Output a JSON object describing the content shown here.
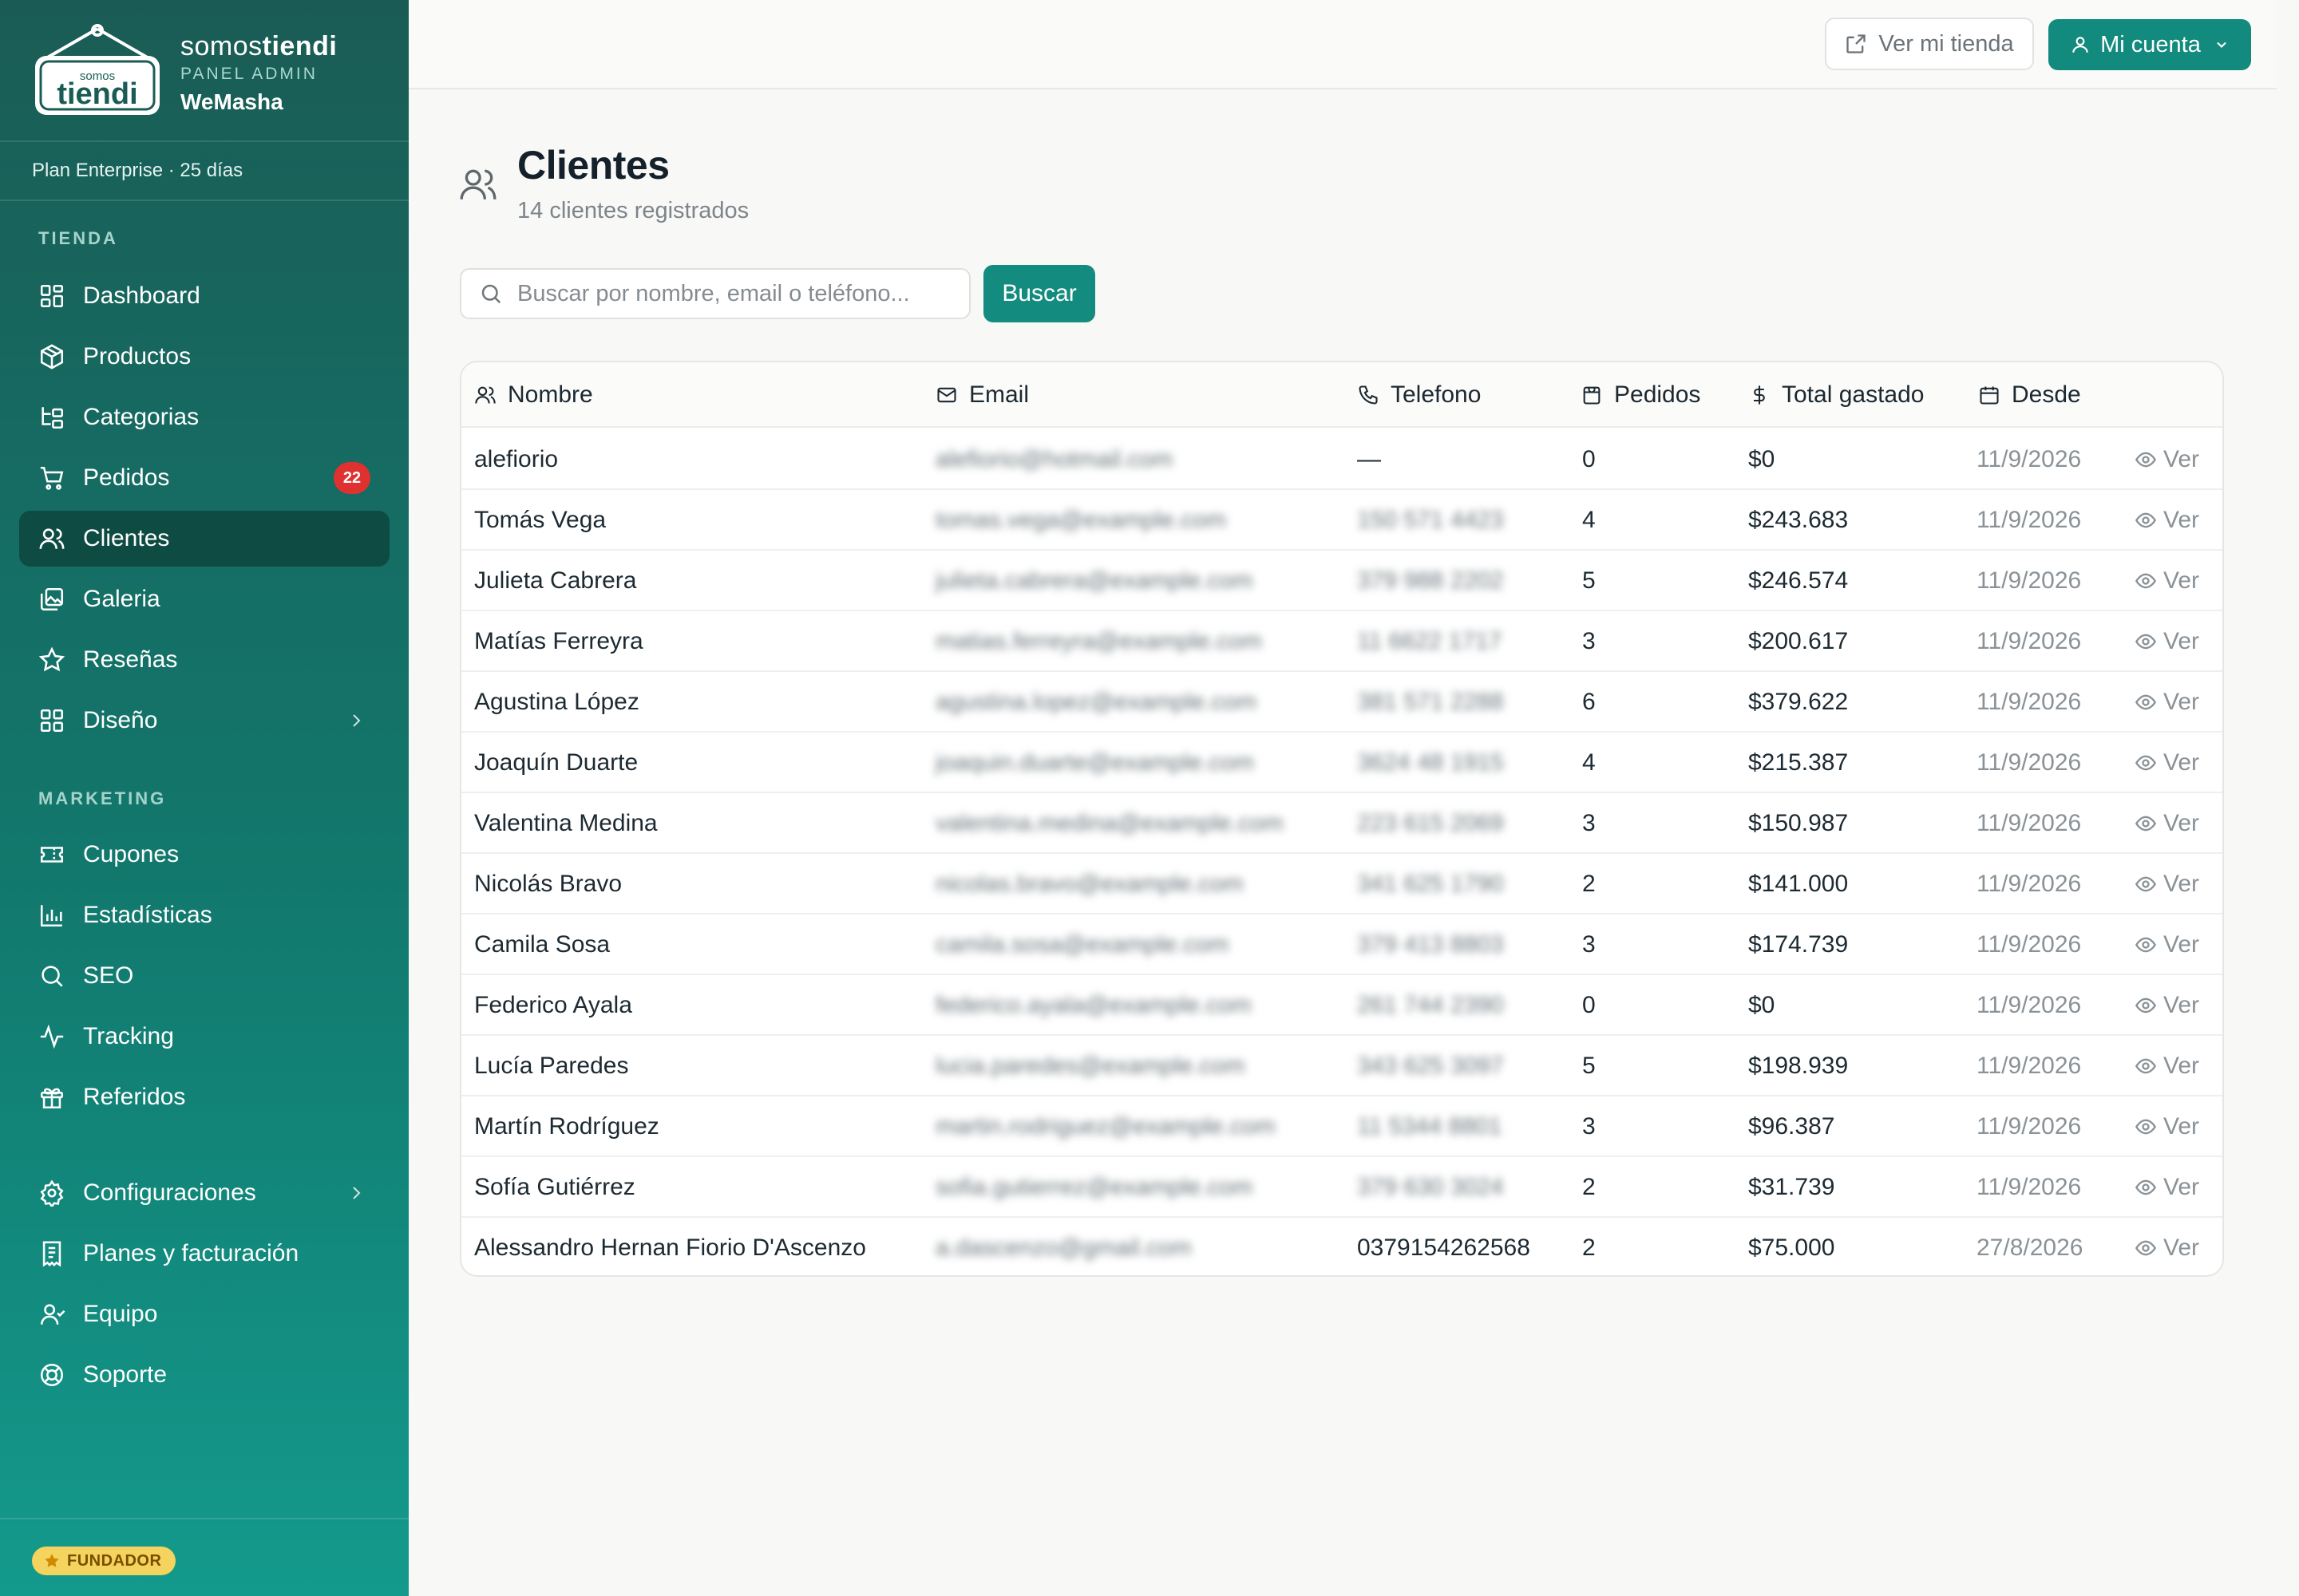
{
  "brand": {
    "logo_small": "somos",
    "logo_big": "tiendi",
    "name_light": "somos",
    "name_bold": "tiendi",
    "subtitle": "PANEL ADMIN",
    "store": "WeMasha"
  },
  "plan": "Plan Enterprise · 25 días",
  "sidebar": {
    "section_tienda": "TIENDA",
    "section_marketing": "MARKETING",
    "items": [
      {
        "label": "Dashboard",
        "icon": "grid-icon"
      },
      {
        "label": "Productos",
        "icon": "box-icon"
      },
      {
        "label": "Categorias",
        "icon": "tree-icon"
      },
      {
        "label": "Pedidos",
        "icon": "cart-icon",
        "badge": "22"
      },
      {
        "label": "Clientes",
        "icon": "users-icon",
        "active": true
      },
      {
        "label": "Galeria",
        "icon": "images-icon"
      },
      {
        "label": "Reseñas",
        "icon": "star-icon"
      },
      {
        "label": "Diseño",
        "icon": "layout-icon"
      },
      {
        "label": "Cupones",
        "icon": "ticket-icon"
      },
      {
        "label": "Estadísticas",
        "icon": "bar-chart-icon"
      },
      {
        "label": "SEO",
        "icon": "search-icon"
      },
      {
        "label": "Tracking",
        "icon": "activity-icon"
      },
      {
        "label": "Referidos",
        "icon": "gift-icon"
      },
      {
        "label": "Configuraciones",
        "icon": "gear-icon"
      },
      {
        "label": "Planes y facturación",
        "icon": "receipt-icon"
      },
      {
        "label": "Equipo",
        "icon": "team-icon"
      },
      {
        "label": "Soporte",
        "icon": "lifebuoy-icon"
      }
    ],
    "founder_badge": "FUNDADOR"
  },
  "topbar": {
    "view_store": "Ver mi tienda",
    "account": "Mi cuenta"
  },
  "page": {
    "title": "Clientes",
    "subtitle": "14 clientes registrados"
  },
  "search": {
    "placeholder": "Buscar por nombre, email o teléfono...",
    "button": "Buscar"
  },
  "table": {
    "headers": {
      "name": "Nombre",
      "email": "Email",
      "phone": "Telefono",
      "orders": "Pedidos",
      "total": "Total gastado",
      "since": "Desde"
    },
    "action_label": "Ver",
    "rows": [
      {
        "name": "alefiorio",
        "email": "alefiorio@hotmail.com",
        "phone": "—",
        "orders": "0",
        "total": "$0",
        "since": "11/9/2026"
      },
      {
        "name": "Tomás Vega",
        "email": "tomas.vega@example.com",
        "phone": "150 571 4423",
        "orders": "4",
        "total": "$243.683",
        "since": "11/9/2026"
      },
      {
        "name": "Julieta Cabrera",
        "email": "julieta.cabrera@example.com",
        "phone": "379 988 2202",
        "orders": "5",
        "total": "$246.574",
        "since": "11/9/2026"
      },
      {
        "name": "Matías Ferreyra",
        "email": "matias.ferreyra@example.com",
        "phone": "11 6622 1717",
        "orders": "3",
        "total": "$200.617",
        "since": "11/9/2026"
      },
      {
        "name": "Agustina López",
        "email": "agustina.lopez@example.com",
        "phone": "381 571 2288",
        "orders": "6",
        "total": "$379.622",
        "since": "11/9/2026"
      },
      {
        "name": "Joaquín Duarte",
        "email": "joaquin.duarte@example.com",
        "phone": "3624 48 1915",
        "orders": "4",
        "total": "$215.387",
        "since": "11/9/2026"
      },
      {
        "name": "Valentina Medina",
        "email": "valentina.medina@example.com",
        "phone": "223 615 2069",
        "orders": "3",
        "total": "$150.987",
        "since": "11/9/2026"
      },
      {
        "name": "Nicolás Bravo",
        "email": "nicolas.bravo@example.com",
        "phone": "341 625 1790",
        "orders": "2",
        "total": "$141.000",
        "since": "11/9/2026"
      },
      {
        "name": "Camila Sosa",
        "email": "camila.sosa@example.com",
        "phone": "379 413 8803",
        "orders": "3",
        "total": "$174.739",
        "since": "11/9/2026"
      },
      {
        "name": "Federico Ayala",
        "email": "federico.ayala@example.com",
        "phone": "261 744 2390",
        "orders": "0",
        "total": "$0",
        "since": "11/9/2026"
      },
      {
        "name": "Lucía Paredes",
        "email": "lucia.paredes@example.com",
        "phone": "343 625 3097",
        "orders": "5",
        "total": "$198.939",
        "since": "11/9/2026"
      },
      {
        "name": "Martín Rodríguez",
        "email": "martin.rodriguez@example.com",
        "phone": "11 5344 8801",
        "orders": "3",
        "total": "$96.387",
        "since": "11/9/2026"
      },
      {
        "name": "Sofía Gutiérrez",
        "email": "sofia.gutierrez@example.com",
        "phone": "379 630 3024",
        "orders": "2",
        "total": "$31.739",
        "since": "11/9/2026"
      },
      {
        "name": "Alessandro Hernan Fiorio D'Ascenzo",
        "email": "a.dascenzo@gmail.com",
        "phone": "0379154262568",
        "phone_visible": true,
        "orders": "2",
        "total": "$75.000",
        "since": "27/8/2026"
      }
    ]
  },
  "colors": {
    "sidebar_top": "#1a5c55",
    "sidebar_bottom": "#139a8c",
    "accent": "#138b7e",
    "badge_red": "#e03131",
    "founder_yellow": "#f4d35e"
  }
}
